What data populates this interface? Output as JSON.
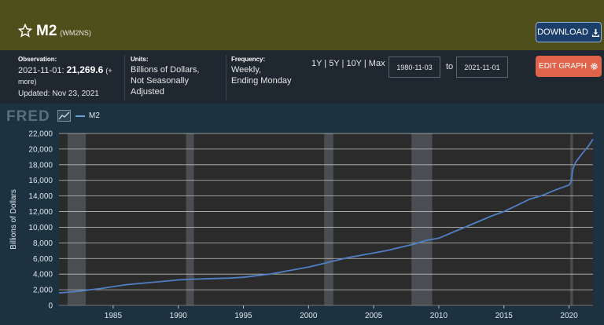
{
  "header": {
    "title": "M2",
    "series_id": "(WM2NS)",
    "download_label": "DOWNLOAD",
    "edit_graph_label": "EDIT GRAPH"
  },
  "meta": {
    "observation_label": "Observation:",
    "observation_date": "2021-11-01:",
    "observation_value": "21,269.6",
    "observation_more": "(+ more)",
    "updated": "Updated: Nov 23, 2021",
    "units_label": "Units:",
    "units_line1": "Billions of Dollars,",
    "units_line2": "Not Seasonally Adjusted",
    "frequency_label": "Frequency:",
    "frequency_line1": "Weekly,",
    "frequency_line2": "Ending Monday"
  },
  "range": {
    "presets": "1Y | 5Y | 10Y | Max",
    "start": "1980-11-03",
    "to_label": "to",
    "end": "2021-11-01"
  },
  "chart_brand": "FRED",
  "colors": {
    "line": "#4f7fc4",
    "recession": "#4a4e52",
    "brand_accent": "#e0644a"
  },
  "icons": {
    "star": "star-icon",
    "download": "download-icon",
    "gear": "gear-icon",
    "fred_graph": "line-graph-icon"
  },
  "chart_data": {
    "type": "line",
    "ylabel": "Billions of Dollars",
    "xlim": [
      1980.84,
      2021.84
    ],
    "ylim": [
      0,
      22000
    ],
    "yticks": [
      0,
      2000,
      4000,
      6000,
      8000,
      10000,
      12000,
      14000,
      16000,
      18000,
      20000,
      22000
    ],
    "ytick_labels": [
      "0",
      "2,000",
      "4,000",
      "6,000",
      "8,000",
      "10,000",
      "12,000",
      "14,000",
      "16,000",
      "18,000",
      "20,000",
      "22,000"
    ],
    "xticks": [
      1985,
      1990,
      1995,
      2000,
      2005,
      2010,
      2015,
      2020
    ],
    "xtick_labels": [
      "1985",
      "1990",
      "1995",
      "2000",
      "2005",
      "2010",
      "2015",
      "2020"
    ],
    "grid": "horizontal",
    "legend": "top-left",
    "recessions": [
      [
        1981.5,
        1982.9
      ],
      [
        1990.6,
        1991.2
      ],
      [
        2001.2,
        2001.9
      ],
      [
        2007.9,
        2009.5
      ],
      [
        2020.1,
        2020.3
      ]
    ],
    "series": [
      {
        "name": "M2",
        "x": [
          1980.84,
          1982,
          1983,
          1984,
          1985,
          1986,
          1987,
          1988,
          1989,
          1990,
          1991,
          1992,
          1993,
          1994,
          1995,
          1996,
          1997,
          1998,
          1999,
          2000,
          2001,
          2002,
          2003,
          2004,
          2005,
          2006,
          2007,
          2008,
          2009,
          2010,
          2011,
          2012,
          2013,
          2014,
          2015,
          2016,
          2017,
          2018,
          2019,
          2020.0,
          2020.15,
          2020.3,
          2020.5,
          2021.0,
          2021.5,
          2021.84
        ],
        "y": [
          1600,
          1750,
          1950,
          2150,
          2400,
          2650,
          2800,
          2950,
          3100,
          3250,
          3350,
          3400,
          3450,
          3500,
          3600,
          3800,
          4000,
          4300,
          4600,
          4900,
          5300,
          5700,
          6100,
          6400,
          6700,
          7000,
          7400,
          7800,
          8300,
          8600,
          9300,
          10000,
          10700,
          11400,
          12000,
          12800,
          13600,
          14100,
          14800,
          15400,
          15800,
          17400,
          18300,
          19400,
          20400,
          21270
        ]
      }
    ]
  }
}
